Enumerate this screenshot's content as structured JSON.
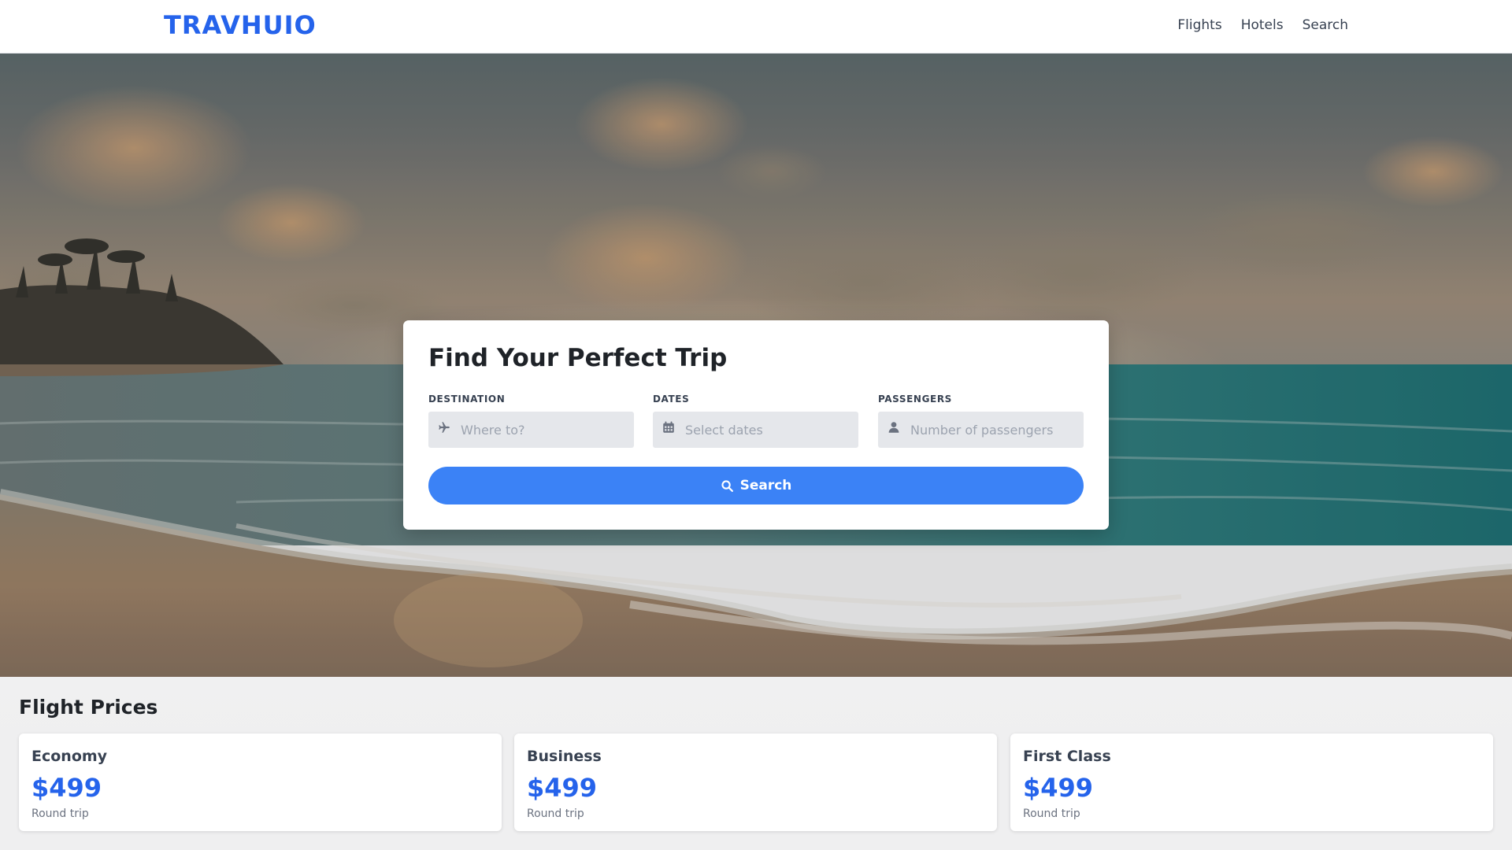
{
  "header": {
    "logo": "TRAVHUIO",
    "nav": [
      "Flights",
      "Hotels",
      "Search"
    ]
  },
  "search": {
    "title": "Find Your Perfect Trip",
    "fields": [
      {
        "label": "DESTINATION",
        "placeholder": "Where to?",
        "icon": "plane-icon"
      },
      {
        "label": "DATES",
        "placeholder": "Select dates",
        "icon": "calendar-icon"
      },
      {
        "label": "PASSENGERS",
        "placeholder": "Number of passengers",
        "icon": "user-icon"
      }
    ],
    "button_label": "Search",
    "button_icon": "magnifier-icon"
  },
  "prices": {
    "title": "Flight Prices",
    "cards": [
      {
        "tier": "Economy",
        "price": "$499",
        "note": "Round trip"
      },
      {
        "tier": "Business",
        "price": "$499",
        "note": "Round trip"
      },
      {
        "tier": "First Class",
        "price": "$499",
        "note": "Round trip"
      }
    ]
  },
  "colors": {
    "brand": "#2563eb",
    "button": "#3b82f6",
    "field_bg": "#e5e7eb"
  }
}
